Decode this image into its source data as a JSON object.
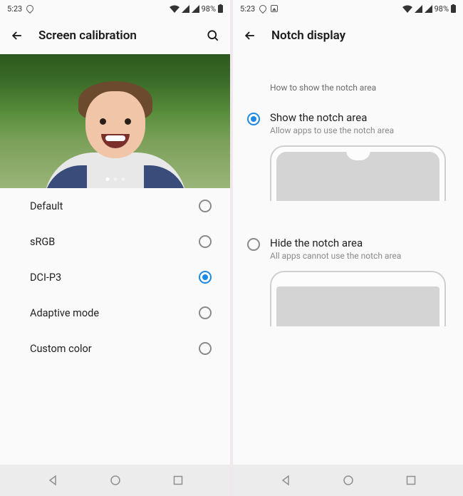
{
  "status": {
    "time": "5:23",
    "battery_pct": "98%"
  },
  "screen_calibration": {
    "title": "Screen calibration",
    "options": [
      {
        "label": "Default",
        "selected": false
      },
      {
        "label": "sRGB",
        "selected": false
      },
      {
        "label": "DCI-P3",
        "selected": true
      },
      {
        "label": "Adaptive mode",
        "selected": false
      },
      {
        "label": "Custom color",
        "selected": false
      }
    ],
    "carousel": {
      "count": 3,
      "active": 0
    }
  },
  "notch_display": {
    "title": "Notch display",
    "section_heading": "How to show the notch area",
    "options": [
      {
        "title": "Show the notch area",
        "subtitle": "Allow apps to use the notch area",
        "selected": true,
        "preview": "with-notch"
      },
      {
        "title": "Hide the notch area",
        "subtitle": "All apps cannot use the notch area",
        "selected": false,
        "preview": "hide-notch"
      }
    ]
  },
  "accent_color": "#1e88e5"
}
